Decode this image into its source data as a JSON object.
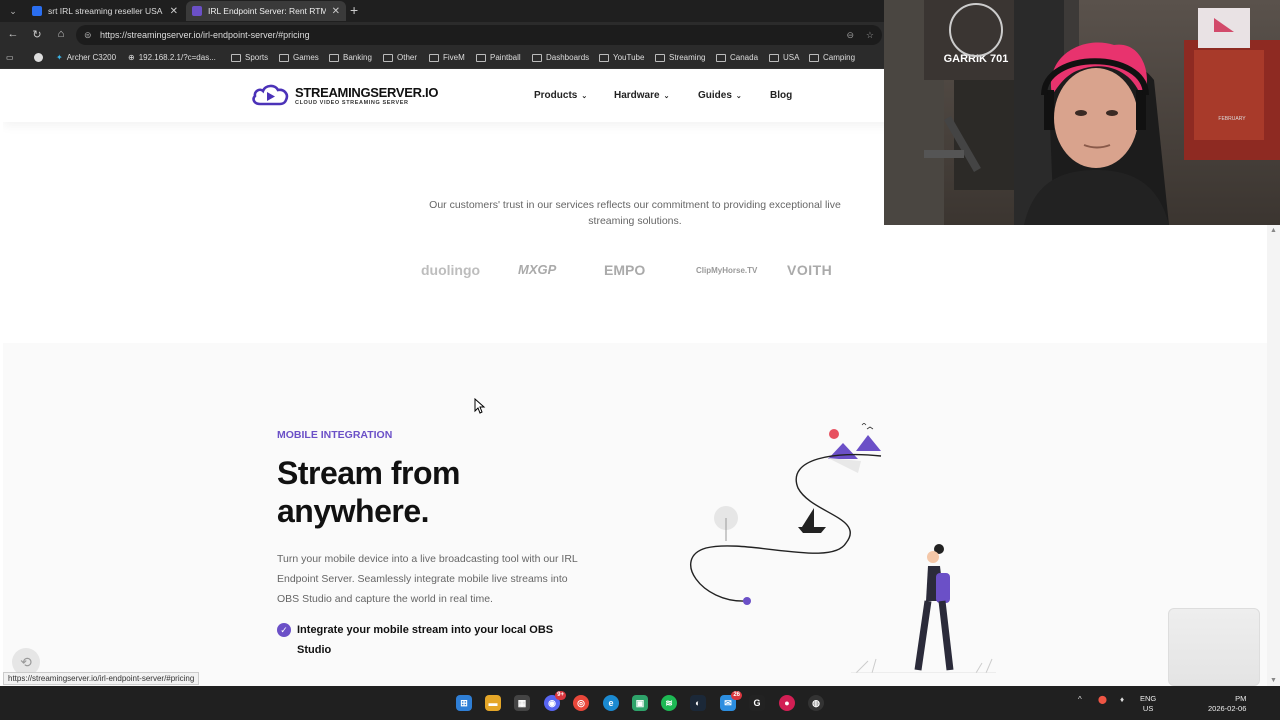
{
  "browser": {
    "tabs": [
      {
        "title": "srt IRL streaming reseller USA - Se",
        "active": false
      },
      {
        "title": "IRL Endpoint Server: Rent RTMP &",
        "active": true
      }
    ],
    "new_tab": "+",
    "url": "https://streamingserver.io/irl-endpoint-server/#pricing",
    "bookmarks": [
      "Archer C3200",
      "192.168.2.1/?c=das...",
      "Sports",
      "Games",
      "Banking",
      "Other",
      "FiveM",
      "Paintball",
      "Dashboards",
      "YouTube",
      "Streaming",
      "Canada",
      "USA",
      "Camping"
    ],
    "status_url": "https://streamingserver.io/irl-endpoint-server/#pricing"
  },
  "site": {
    "logo_title": "STREAMINGSERVER.IO",
    "logo_sub": "CLOUD VIDEO STREAMING SERVER",
    "nav": [
      {
        "label": "Products"
      },
      {
        "label": "Hardware"
      },
      {
        "label": "Guides"
      },
      {
        "label": "Blog"
      }
    ],
    "trust_text": "Our customers' trust in our services reflects our commitment to providing exceptional live streaming solutions.",
    "brands": [
      "duolingo",
      "MXGP",
      "EMPO",
      "ClipMyHorse.TV",
      "VOITH"
    ],
    "eyebrow": "MOBILE INTEGRATION",
    "headline_line1": "Stream from",
    "headline_line2": "anywhere.",
    "body": "Turn your mobile device into a live broadcasting tool with our IRL Endpoint Server. Seamlessly integrate mobile live streams into OBS Studio and capture the world in real time.",
    "check_item": "Integrate your mobile stream into your local OBS Studio",
    "accent_color": "#6b50c7"
  },
  "webcam": {
    "sign_text": "GARRIK 701",
    "calendar_text": "FEBRUARY"
  },
  "taskbar": {
    "badges": {
      "discord": "9+",
      "mail": "26"
    },
    "lang_line1": "ENG",
    "lang_line2": "US",
    "time": "PM",
    "date": "2026-02-06"
  }
}
